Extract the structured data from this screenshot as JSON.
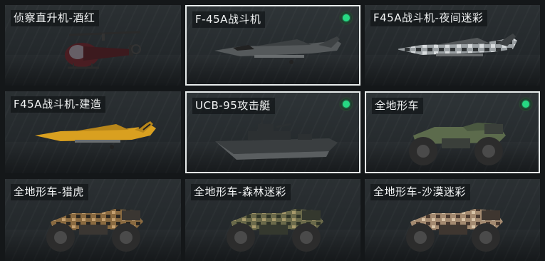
{
  "vehicles": [
    {
      "name": "侦察直升机-酒红",
      "equipped": false,
      "selected": false,
      "icon": "helicopter-icon"
    },
    {
      "name": "F-45A战斗机",
      "equipped": true,
      "selected": true,
      "icon": "fighter-jet-icon"
    },
    {
      "name": "F45A战斗机-夜间迷彩",
      "equipped": false,
      "selected": false,
      "icon": "fighter-jet-icon"
    },
    {
      "name": "F45A战斗机-建造",
      "equipped": false,
      "selected": false,
      "icon": "fighter-jet-icon"
    },
    {
      "name": "UCB-95攻击艇",
      "equipped": true,
      "selected": true,
      "icon": "attack-boat-icon"
    },
    {
      "name": "全地形车",
      "equipped": true,
      "selected": true,
      "icon": "atv-icon"
    },
    {
      "name": "全地形车-猎虎",
      "equipped": false,
      "selected": false,
      "icon": "atv-icon"
    },
    {
      "name": "全地形车-森林迷彩",
      "equipped": false,
      "selected": false,
      "icon": "atv-icon"
    },
    {
      "name": "全地形车-沙漠迷彩",
      "equipped": false,
      "selected": false,
      "icon": "atv-icon"
    }
  ],
  "colors": {
    "equipped_indicator": "#27d983",
    "selected_border": "#e8ecec",
    "card_background": "#262b2e"
  }
}
